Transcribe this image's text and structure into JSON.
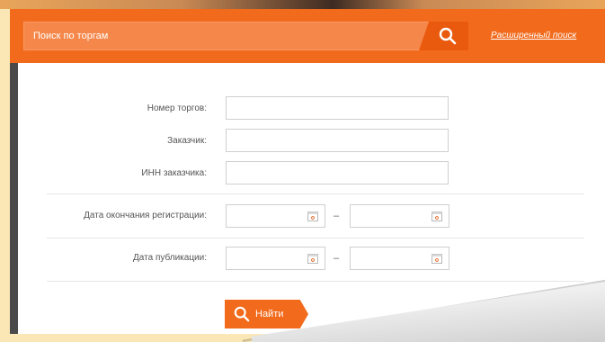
{
  "search": {
    "placeholder": "Поиск по торгам",
    "advanced_link": "Расширенный поиск"
  },
  "form": {
    "tender_number_label": "Номер торгов:",
    "customer_label": "Заказчик:",
    "customer_inn_label": "ИНН заказчика:",
    "registration_end_label": "Дата окончания регистрации:",
    "publication_date_label": "Дата публикации:",
    "range_dash": "–"
  },
  "actions": {
    "find_label": "Найти"
  },
  "colors": {
    "accent": "#f26a1b",
    "accent_dark": "#ea5a0e",
    "page_background": "#fbe7b5"
  },
  "icons": [
    "search-icon",
    "calendar-icon"
  ]
}
